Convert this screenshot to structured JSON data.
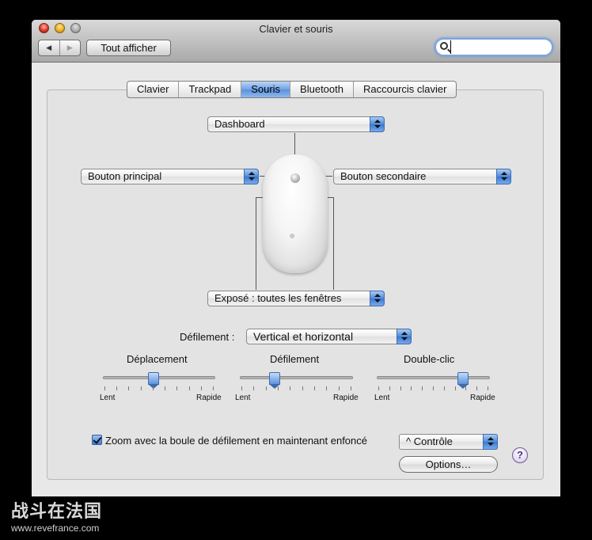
{
  "window": {
    "title": "Clavier et souris"
  },
  "toolbar": {
    "back_icon": "◀",
    "forward_icon": "▶",
    "show_all_label": "Tout afficher",
    "search_value": ""
  },
  "tabs": [
    {
      "label": "Clavier"
    },
    {
      "label": "Trackpad"
    },
    {
      "label": "Souris",
      "active": true
    },
    {
      "label": "Bluetooth"
    },
    {
      "label": "Raccourcis clavier"
    }
  ],
  "mouse": {
    "top_popup": "Dashboard",
    "left_popup": "Bouton principal",
    "right_popup": "Bouton secondaire",
    "bottom_popup": "Exposé : toutes les fenêtres"
  },
  "scrolling": {
    "label": "Défilement :",
    "value": "Vertical et horizontal"
  },
  "sliders": [
    {
      "title": "Déplacement",
      "min_label": "Lent",
      "max_label": "Rapide",
      "value": 0.45
    },
    {
      "title": "Défilement",
      "min_label": "Lent",
      "max_label": "Rapide",
      "value": 0.31
    },
    {
      "title": "Double-clic",
      "min_label": "Lent",
      "max_label": "Rapide",
      "value": 0.76
    }
  ],
  "zoom": {
    "label": "Zoom avec la boule de défilement en maintenant enfoncé",
    "checked": true,
    "modifier": "^ Contrôle",
    "options_label": "Options…"
  },
  "help_label": "?",
  "watermark": {
    "brand": "战斗在法国",
    "url": "www.revefrance.com"
  },
  "colors": {
    "accent": "#5a91de",
    "background": "#e8e8e8"
  }
}
